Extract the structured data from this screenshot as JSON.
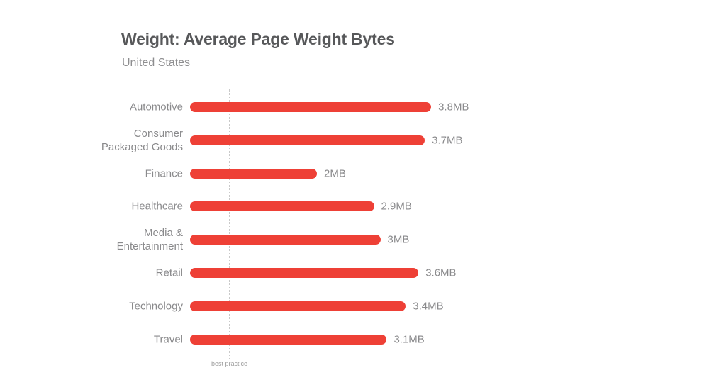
{
  "header": {
    "title": "Weight: Average Page Weight Bytes",
    "subtitle": "United States"
  },
  "annotation": {
    "best_practice_label": "best practice"
  },
  "colors": {
    "bar": "#ee4036",
    "label_text": "#8a8a8c",
    "title_text": "#57585a",
    "subtitle_text": "#8d8d8f",
    "reference_line": "#c9c9c9",
    "background": "#ffffff"
  },
  "chart_data": {
    "type": "bar",
    "orientation": "horizontal",
    "title": "Weight: Average Page Weight Bytes",
    "subtitle": "United States",
    "xlabel": "",
    "ylabel": "",
    "unit": "MB",
    "xlim": [
      0,
      4
    ],
    "grid": false,
    "legend": false,
    "reference_line": {
      "label": "best practice",
      "value": 0.62,
      "style": "dotted",
      "orientation": "vertical"
    },
    "categories": [
      "Automotive",
      "Consumer\nPackaged Goods",
      "Finance",
      "Healthcare",
      "Media &\nEntertainment",
      "Retail",
      "Technology",
      "Travel"
    ],
    "values": [
      3.8,
      3.7,
      2.0,
      2.9,
      3.0,
      3.6,
      3.4,
      3.1
    ],
    "value_labels": [
      "3.8MB",
      "3.7MB",
      "2MB",
      "2.9MB",
      "3MB",
      "3.6MB",
      "3.4MB",
      "3.1MB"
    ]
  }
}
